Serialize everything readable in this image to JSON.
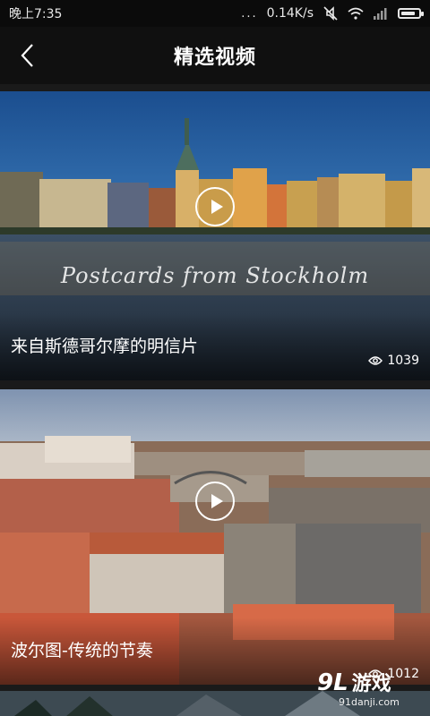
{
  "status_bar": {
    "time": "晚上7:35",
    "signal_dots": "...",
    "network_speed": "0.14K/s",
    "icons": [
      "mute-icon",
      "wifi-icon",
      "signal-icon",
      "battery-icon"
    ],
    "battery_level": 0.85
  },
  "header": {
    "back_icon": "chevron-left-icon",
    "title": "精选视频"
  },
  "videos": [
    {
      "overlay_text": "Postcards from Stockholm",
      "title": "来自斯德哥尔摩的明信片",
      "views": "1039"
    },
    {
      "title": "波尔图-传统的节奏",
      "views": "1012"
    },
    {}
  ],
  "watermark": {
    "logo_number": "9L",
    "logo_name": "游戏",
    "url": "91danji.com"
  },
  "colors": {
    "background": "#121212",
    "header_bg": "#101010",
    "text": "#ffffff"
  }
}
